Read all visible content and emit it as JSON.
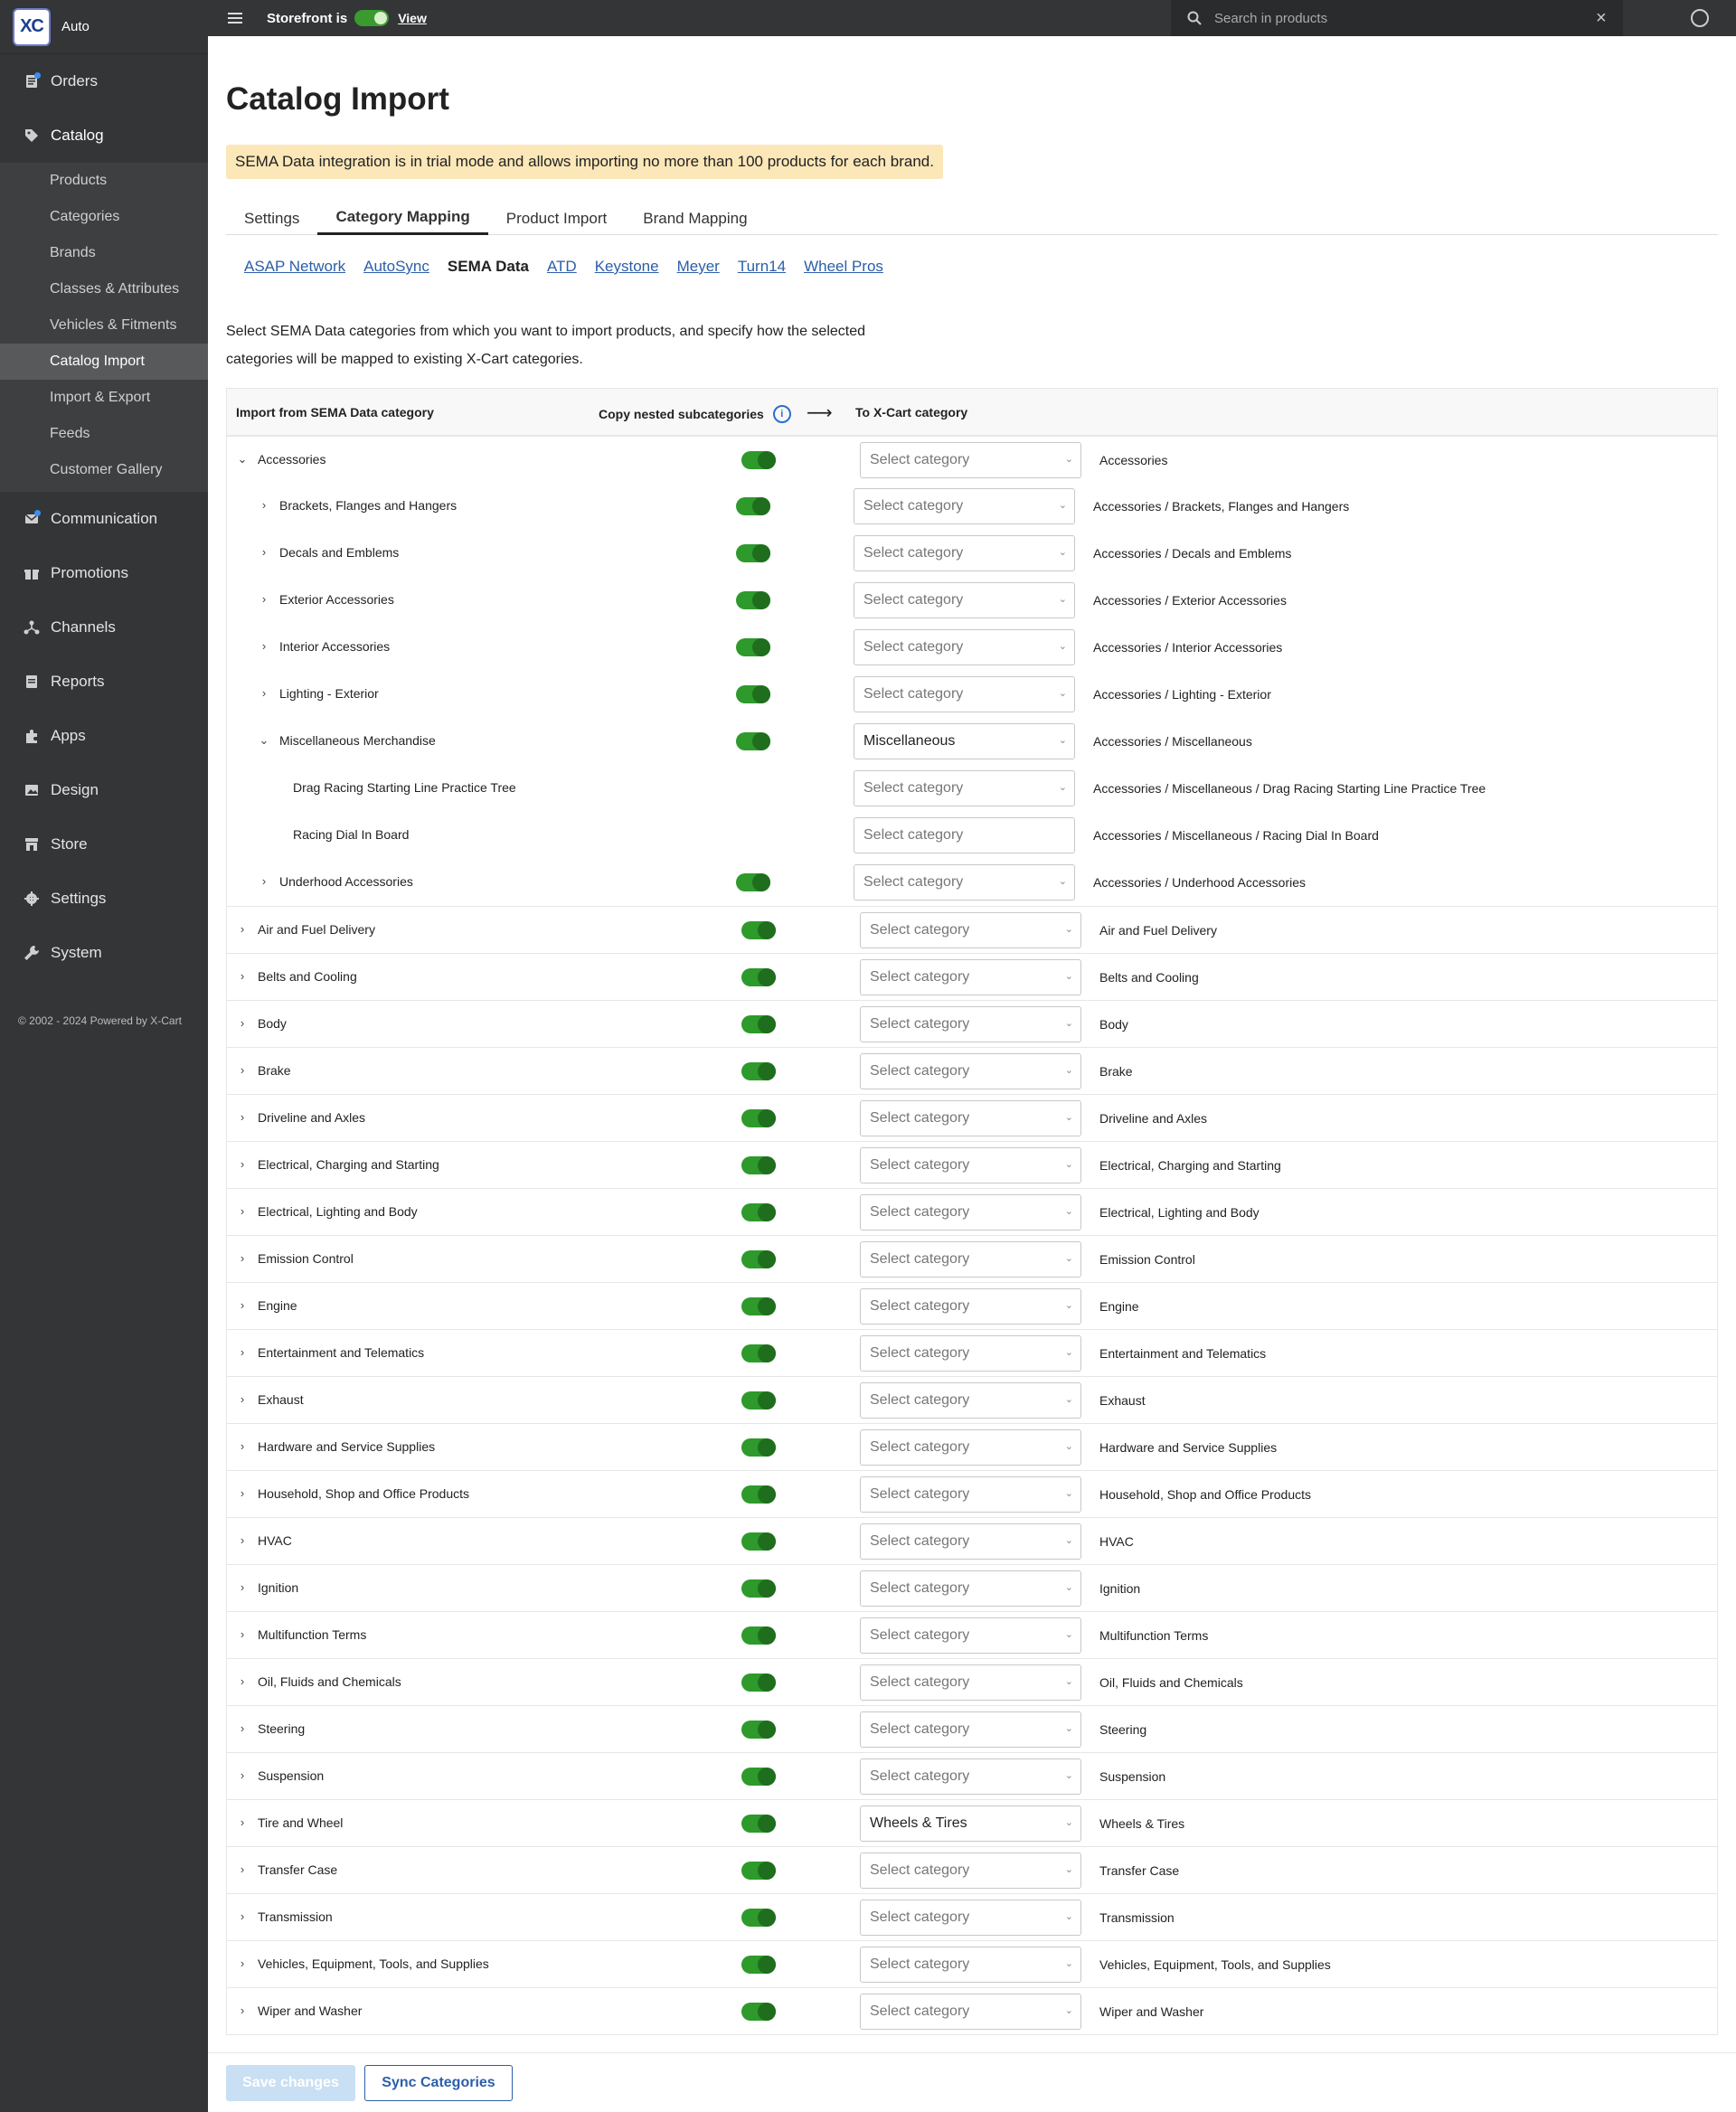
{
  "brand": {
    "logo": "XC",
    "name": "Auto"
  },
  "topbar": {
    "storefront_label": "Storefront is",
    "view_label": "View",
    "search_placeholder": "Search in products"
  },
  "sidebar": {
    "items": [
      {
        "label": "Orders",
        "icon": "orders-icon",
        "dot": true
      },
      {
        "label": "Catalog",
        "icon": "tag-icon",
        "dot": false
      },
      {
        "label": "Communication",
        "icon": "mail-icon",
        "dot": true
      },
      {
        "label": "Promotions",
        "icon": "gift-icon",
        "dot": false
      },
      {
        "label": "Channels",
        "icon": "channels-icon",
        "dot": false
      },
      {
        "label": "Reports",
        "icon": "report-icon",
        "dot": false
      },
      {
        "label": "Apps",
        "icon": "puzzle-icon",
        "dot": false
      },
      {
        "label": "Design",
        "icon": "image-icon",
        "dot": false
      },
      {
        "label": "Store",
        "icon": "store-icon",
        "dot": false
      },
      {
        "label": "Settings",
        "icon": "gear-icon",
        "dot": false
      },
      {
        "label": "System",
        "icon": "wrench-icon",
        "dot": false
      }
    ],
    "catalog_sub": [
      "Products",
      "Categories",
      "Brands",
      "Classes & Attributes",
      "Vehicles & Fitments",
      "Catalog Import",
      "Import & Export",
      "Feeds",
      "Customer Gallery"
    ],
    "copyright": "© 2002 - 2024 Powered by X-Cart"
  },
  "page": {
    "title": "Catalog Import",
    "notice": "SEMA Data integration is in trial mode and allows importing no more than 100 products for each brand.",
    "tabs": [
      "Settings",
      "Category Mapping",
      "Product Import",
      "Brand Mapping"
    ],
    "subtabs": [
      "ASAP Network",
      "AutoSync",
      "SEMA Data",
      "ATD",
      "Keystone",
      "Meyer",
      "Turn14",
      "Wheel Pros"
    ],
    "description": "Select SEMA Data categories from which you want to import products, and specify how the selected categories will be mapped to existing X-Cart categories."
  },
  "table": {
    "header_from": "Import from SEMA Data category",
    "header_copy": "Copy nested subcategories",
    "header_to": "To X-Cart category",
    "select_placeholder": "Select category",
    "rows": [
      {
        "name": "Accessories",
        "level": 0,
        "expanded": true,
        "toggle": true,
        "value": "",
        "path": "Accessories"
      },
      {
        "name": "Brackets, Flanges and Hangers",
        "level": 1,
        "expanded": false,
        "toggle": true,
        "value": "",
        "path": "Accessories / Brackets, Flanges and Hangers"
      },
      {
        "name": "Decals and Emblems",
        "level": 1,
        "expanded": false,
        "toggle": true,
        "value": "",
        "path": "Accessories / Decals and Emblems"
      },
      {
        "name": "Exterior Accessories",
        "level": 1,
        "expanded": false,
        "toggle": true,
        "value": "",
        "path": "Accessories / Exterior Accessories"
      },
      {
        "name": "Interior Accessories",
        "level": 1,
        "expanded": false,
        "toggle": true,
        "value": "",
        "path": "Accessories / Interior Accessories"
      },
      {
        "name": "Lighting - Exterior",
        "level": 1,
        "expanded": false,
        "toggle": true,
        "value": "",
        "path": "Accessories / Lighting - Exterior"
      },
      {
        "name": "Miscellaneous Merchandise",
        "level": 1,
        "expanded": true,
        "toggle": true,
        "value": "Miscellaneous",
        "path": "Accessories / Miscellaneous"
      },
      {
        "name": "Drag Racing Starting Line Practice Tree",
        "level": 2,
        "leaf": true,
        "toggle": false,
        "value": "",
        "path": "Accessories / Miscellaneous / Drag Racing Starting Line Practice Tree"
      },
      {
        "name": "Racing Dial In Board",
        "level": 2,
        "leaf": true,
        "toggle": false,
        "value": "",
        "path": "Accessories / Miscellaneous / Racing Dial In Board"
      },
      {
        "name": "Underhood Accessories",
        "level": 1,
        "expanded": false,
        "toggle": true,
        "value": "",
        "path": "Accessories / Underhood Accessories"
      },
      {
        "name": "Air and Fuel Delivery",
        "level": 0,
        "expanded": false,
        "toggle": true,
        "value": "",
        "path": "Air and Fuel Delivery"
      },
      {
        "name": "Belts and Cooling",
        "level": 0,
        "expanded": false,
        "toggle": true,
        "value": "",
        "path": "Belts and Cooling"
      },
      {
        "name": "Body",
        "level": 0,
        "expanded": false,
        "toggle": true,
        "value": "",
        "path": "Body"
      },
      {
        "name": "Brake",
        "level": 0,
        "expanded": false,
        "toggle": true,
        "value": "",
        "path": "Brake"
      },
      {
        "name": "Driveline and Axles",
        "level": 0,
        "expanded": false,
        "toggle": true,
        "value": "",
        "path": "Driveline and Axles"
      },
      {
        "name": "Electrical, Charging and Starting",
        "level": 0,
        "expanded": false,
        "toggle": true,
        "value": "",
        "path": "Electrical, Charging and Starting"
      },
      {
        "name": "Electrical, Lighting and Body",
        "level": 0,
        "expanded": false,
        "toggle": true,
        "value": "",
        "path": "Electrical, Lighting and Body"
      },
      {
        "name": "Emission Control",
        "level": 0,
        "expanded": false,
        "toggle": true,
        "value": "",
        "path": "Emission Control"
      },
      {
        "name": "Engine",
        "level": 0,
        "expanded": false,
        "toggle": true,
        "value": "",
        "path": "Engine"
      },
      {
        "name": "Entertainment and Telematics",
        "level": 0,
        "expanded": false,
        "toggle": true,
        "value": "",
        "path": "Entertainment and Telematics"
      },
      {
        "name": "Exhaust",
        "level": 0,
        "expanded": false,
        "toggle": true,
        "value": "",
        "path": "Exhaust"
      },
      {
        "name": "Hardware and Service Supplies",
        "level": 0,
        "expanded": false,
        "toggle": true,
        "value": "",
        "path": "Hardware and Service Supplies"
      },
      {
        "name": "Household, Shop and Office Products",
        "level": 0,
        "expanded": false,
        "toggle": true,
        "value": "",
        "path": "Household, Shop and Office Products"
      },
      {
        "name": "HVAC",
        "level": 0,
        "expanded": false,
        "toggle": true,
        "value": "",
        "path": "HVAC"
      },
      {
        "name": "Ignition",
        "level": 0,
        "expanded": false,
        "toggle": true,
        "value": "",
        "path": "Ignition"
      },
      {
        "name": "Multifunction Terms",
        "level": 0,
        "expanded": false,
        "toggle": true,
        "value": "",
        "path": "Multifunction Terms"
      },
      {
        "name": "Oil, Fluids and Chemicals",
        "level": 0,
        "expanded": false,
        "toggle": true,
        "value": "",
        "path": "Oil, Fluids and Chemicals"
      },
      {
        "name": "Steering",
        "level": 0,
        "expanded": false,
        "toggle": true,
        "value": "",
        "path": "Steering"
      },
      {
        "name": "Suspension",
        "level": 0,
        "expanded": false,
        "toggle": true,
        "value": "",
        "path": "Suspension"
      },
      {
        "name": "Tire and Wheel",
        "level": 0,
        "expanded": false,
        "toggle": true,
        "value": "Wheels & Tires",
        "path": "Wheels & Tires"
      },
      {
        "name": "Transfer Case",
        "level": 0,
        "expanded": false,
        "toggle": true,
        "value": "",
        "path": "Transfer Case"
      },
      {
        "name": "Transmission",
        "level": 0,
        "expanded": false,
        "toggle": true,
        "value": "",
        "path": "Transmission"
      },
      {
        "name": "Vehicles, Equipment, Tools, and Supplies",
        "level": 0,
        "expanded": false,
        "toggle": true,
        "value": "",
        "path": "Vehicles, Equipment, Tools, and Supplies"
      },
      {
        "name": "Wiper and Washer",
        "level": 0,
        "expanded": false,
        "toggle": true,
        "value": "",
        "path": "Wiper and Washer"
      }
    ]
  },
  "footer": {
    "save_label": "Save changes",
    "sync_label": "Sync Categories"
  },
  "colors": {
    "sidebar_bg": "#333536",
    "toggle_on": "#2d9a2b",
    "link": "#2c5ea8",
    "notice_bg": "#fbe7b8"
  }
}
